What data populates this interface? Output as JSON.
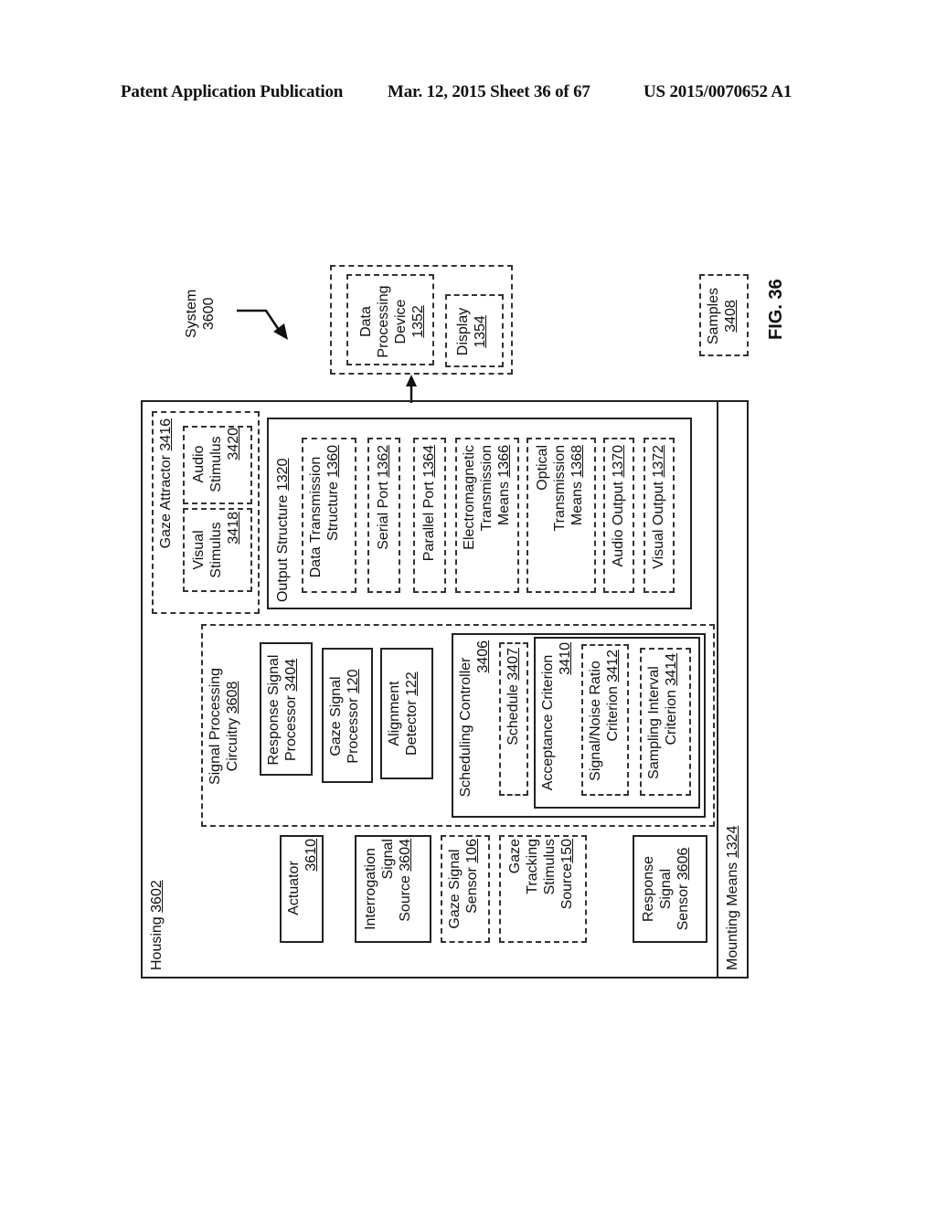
{
  "header": {
    "publication": "Patent Application Publication",
    "date_sheet": "Mar. 12, 2015  Sheet 36 of 67",
    "patent_number": "US 2015/0070652 A1"
  },
  "figure": {
    "label": "FIG. 36",
    "system": {
      "name": "System",
      "ref": "3600"
    },
    "external_device": {
      "data_processing_device": {
        "lines": [
          "Data",
          "Processing",
          "Device"
        ],
        "ref": "1352"
      },
      "display": {
        "name": "Display",
        "ref": "1354"
      }
    },
    "samples": {
      "name": "Samples",
      "ref": "3408"
    },
    "housing": {
      "name": "Housing",
      "ref": "3602"
    },
    "mounting_means": {
      "name": "Mounting Means",
      "ref": "1324"
    },
    "gaze_attractor": {
      "name": "Gaze Attractor",
      "ref": "3416",
      "visual_stimulus": {
        "lines": [
          "Visual",
          "Stimulus"
        ],
        "ref": "3418"
      },
      "audio_stimulus": {
        "lines": [
          "Audio",
          "Stimulus"
        ],
        "ref": "3420"
      }
    },
    "output_structure": {
      "name": "Output Structure",
      "ref": "1320",
      "items": [
        {
          "lines": [
            "Data Transmission",
            "Structure"
          ],
          "ref": "1360"
        },
        {
          "lines": [
            "Serial Port "
          ],
          "ref": "1362"
        },
        {
          "lines": [
            "Parallel Port "
          ],
          "ref": "1364"
        },
        {
          "lines": [
            "Electromagnetic",
            "Transmission",
            "Means"
          ],
          "ref": "1366"
        },
        {
          "lines": [
            "Optical",
            "Transmission",
            "Means"
          ],
          "ref": "1368"
        },
        {
          "lines": [
            "Audio Output"
          ],
          "ref": "1370"
        },
        {
          "lines": [
            "Visual Output"
          ],
          "ref": "1372"
        }
      ]
    },
    "signal_processing": {
      "lines": [
        "Signal Processing",
        "Circuitry "
      ],
      "ref": "3608",
      "response_signal_processor": {
        "lines": [
          "Response Signal",
          "Processor"
        ],
        "ref": "3404"
      },
      "gaze_signal_processor": {
        "lines": [
          "Gaze Signal",
          "Processor"
        ],
        "ref": "120"
      },
      "alignment_detector": {
        "lines": [
          "Alignment",
          "Detector"
        ],
        "ref": "122"
      },
      "scheduling_controller": {
        "name": "Scheduling Controller",
        "ref": "3406",
        "schedule": {
          "name": "Schedule",
          "ref": "3407"
        },
        "acceptance_criterion": {
          "name": "Acceptance Criterion",
          "ref": "3410",
          "snr": {
            "lines": [
              "Signal/Noise Ratio",
              "Criterion"
            ],
            "ref": "3412"
          },
          "sampling": {
            "lines": [
              "Sampling Interval",
              "Criterion"
            ],
            "ref": "3414"
          }
        }
      }
    },
    "actuator": {
      "name": "Actuator",
      "ref": "3610"
    },
    "interrogation_source": {
      "lines": [
        "Interrogation",
        "Signal",
        "Source"
      ],
      "ref": "3604"
    },
    "gaze_signal_sensor": {
      "lines": [
        "Gaze Signal",
        "Sensor"
      ],
      "ref": "106"
    },
    "gaze_tracking_source": {
      "lines": [
        "Gaze",
        "Tracking",
        "Stimulus",
        "Source"
      ],
      "ref": "150"
    },
    "response_signal_sensor": {
      "lines": [
        "Response",
        "Signal",
        "Sensor"
      ],
      "ref": "3606"
    }
  }
}
